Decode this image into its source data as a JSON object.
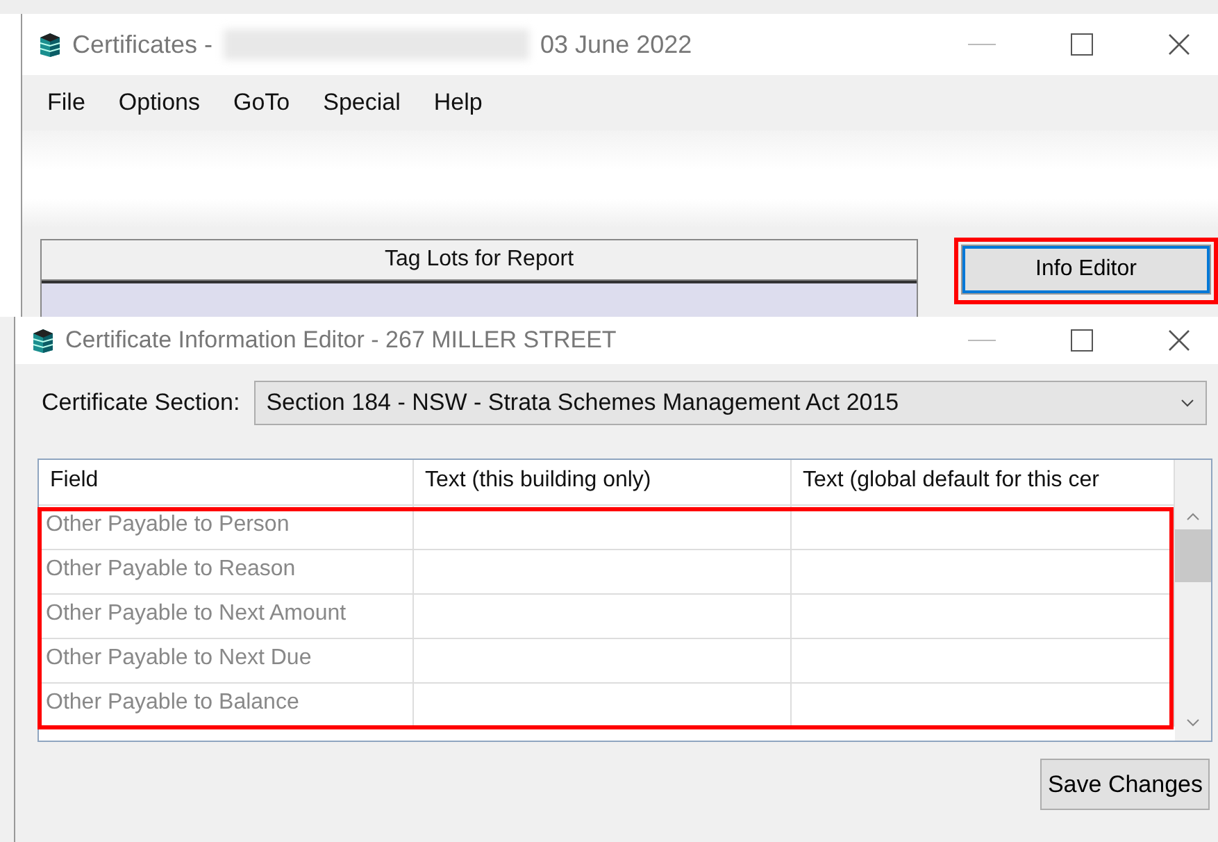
{
  "main_window": {
    "title_prefix": "Certificates -",
    "title_redacted": true,
    "title_date": "03 June 2022",
    "menu": [
      "File",
      "Options",
      "GoTo",
      "Special",
      "Help"
    ],
    "panel_title": "Tag Lots for Report",
    "info_button": {
      "label": "Info Editor",
      "highlighted": true
    }
  },
  "editor_window": {
    "title": "Certificate Information Editor - 267 MILLER STREET",
    "section_label": "Certificate Section:",
    "section_value": "Section 184 - NSW - Strata Schemes Management Act 2015",
    "table": {
      "columns": [
        "Field",
        "Text (this building only)",
        "Text (global default for this cer"
      ],
      "highlighted": true,
      "rows": [
        {
          "field": "Other Payable to Person"
        },
        {
          "field": "Other Payable to Reason"
        },
        {
          "field": "Other Payable to Next Amount"
        },
        {
          "field": "Other Payable to Next Due"
        },
        {
          "field": "Other Payable to Balance"
        }
      ]
    },
    "save_button": "Save Changes"
  }
}
